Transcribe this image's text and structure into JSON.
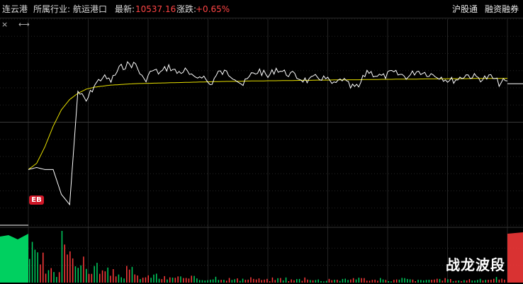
{
  "header": {
    "stock_name": "连云港",
    "industry_label": "所属行业:",
    "industry_value": "航运港口",
    "latest_label": "最新:",
    "latest_value": "10537.16",
    "change_label": "涨跌:",
    "change_value": "+0.65%",
    "link_shanghai_connect": "沪股通",
    "link_margin": "融资融券"
  },
  "toolbar": {
    "close_icon": "×",
    "expand_icon": "⟷"
  },
  "badge": {
    "label": "EB"
  },
  "watermark": "战龙波段",
  "colors": {
    "price_line": "#ffffff",
    "avg_line": "#e8e000",
    "up": "#ff3b3b",
    "down": "#00d060",
    "grid": "#242424",
    "accent_text": "#ff4545",
    "badge_bg": "#d01828"
  },
  "chart_data": {
    "type": "line",
    "title": "",
    "y_range_relative": [
      0.0,
      1.0
    ],
    "note_axis": "intraday minute chart; price axis unlabeled in view",
    "price_samples": [
      0.73,
      0.72,
      0.73,
      0.73,
      0.85,
      0.9,
      0.35,
      0.4,
      0.32,
      0.28,
      0.3,
      0.24,
      0.22,
      0.22,
      0.3,
      0.25,
      0.26,
      0.23,
      0.26,
      0.25,
      0.29,
      0.27,
      0.32,
      0.26,
      0.26,
      0.28,
      0.32,
      0.27,
      0.25,
      0.28,
      0.24,
      0.26,
      0.27,
      0.29,
      0.3,
      0.28,
      0.29,
      0.32,
      0.29,
      0.33,
      0.33,
      0.25,
      0.27,
      0.28,
      0.26,
      0.27,
      0.28,
      0.25,
      0.26,
      0.27,
      0.28,
      0.3,
      0.29,
      0.27,
      0.28,
      0.29,
      0.28,
      0.31,
      0.3
    ],
    "avg_samples": [
      0.73,
      0.7,
      0.62,
      0.52,
      0.44,
      0.39,
      0.36,
      0.34,
      0.33,
      0.325,
      0.32,
      0.318,
      0.315,
      0.313,
      0.312,
      0.311,
      0.31,
      0.309,
      0.308,
      0.307,
      0.306,
      0.305,
      0.304,
      0.303,
      0.302,
      0.302,
      0.301,
      0.3,
      0.3,
      0.299,
      0.299,
      0.298,
      0.298,
      0.297,
      0.297,
      0.296,
      0.296,
      0.295,
      0.295,
      0.294,
      0.294,
      0.293,
      0.293,
      0.292,
      0.292,
      0.291,
      0.291,
      0.291,
      0.29,
      0.29,
      0.29,
      0.289,
      0.289,
      0.289,
      0.288,
      0.288,
      0.288,
      0.288,
      0.287
    ],
    "volume_samples": [
      0.55,
      0.4,
      0.2,
      0.15,
      0.9,
      0.6,
      0.35,
      0.25,
      0.3,
      0.2,
      0.18,
      0.15,
      0.22,
      0.12,
      0.1,
      0.14,
      0.09,
      0.08,
      0.12,
      0.07,
      0.09,
      0.06,
      0.08,
      0.1,
      0.07,
      0.06,
      0.05,
      0.09,
      0.06,
      0.05,
      0.07,
      0.08,
      0.05,
      0.06,
      0.09,
      0.05,
      0.04,
      0.07,
      0.05,
      0.06,
      0.1,
      0.07,
      0.05,
      0.06,
      0.04,
      0.05,
      0.07,
      0.05,
      0.04,
      0.06,
      0.05,
      0.07,
      0.05,
      0.04,
      0.06,
      0.05,
      0.06,
      0.08,
      0.05
    ]
  }
}
